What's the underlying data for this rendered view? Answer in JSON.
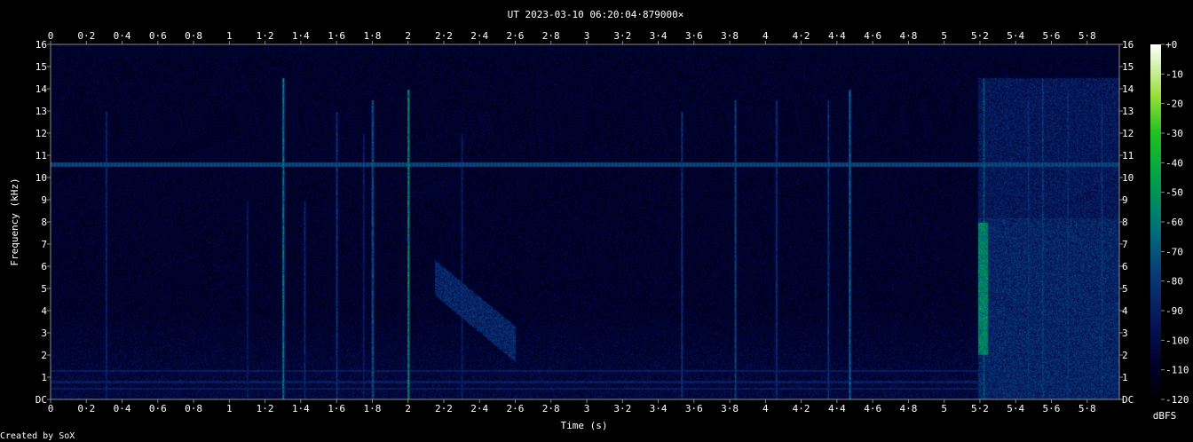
{
  "title": "UT 2023-03-10 06:20:04·879000×",
  "footer": "Created by SoX",
  "chart_data": {
    "type": "heatmap",
    "title": "UT 2023-03-10 06:20:04·879000×",
    "xlabel": "Time (s)",
    "ylabel": "Frequency (kHz)",
    "xlim": [
      0,
      5.98
    ],
    "ylim": [
      0,
      16
    ],
    "x_ticks": [
      "0",
      "0·2",
      "0·4",
      "0·6",
      "0·8",
      "1",
      "1·2",
      "1·4",
      "1·6",
      "1·8",
      "2",
      "2·2",
      "2·4",
      "2·6",
      "2·8",
      "3",
      "3·2",
      "3·4",
      "3·6",
      "3·8",
      "4",
      "4·2",
      "4·4",
      "4·6",
      "4·8",
      "5",
      "5·2",
      "5·4",
      "5·6",
      "5·8"
    ],
    "x_tick_values": [
      0,
      0.2,
      0.4,
      0.6,
      0.8,
      1,
      1.2,
      1.4,
      1.6,
      1.8,
      2,
      2.2,
      2.4,
      2.6,
      2.8,
      3,
      3.2,
      3.4,
      3.6,
      3.8,
      4,
      4.2,
      4.4,
      4.6,
      4.8,
      5,
      5.2,
      5.4,
      5.6,
      5.8
    ],
    "y_ticks": [
      "DC",
      "1",
      "2",
      "3",
      "4",
      "5",
      "6",
      "7",
      "8",
      "9",
      "10",
      "11",
      "12",
      "13",
      "14",
      "15",
      "16"
    ],
    "y_tick_values": [
      0,
      1,
      2,
      3,
      4,
      5,
      6,
      7,
      8,
      9,
      10,
      11,
      12,
      13,
      14,
      15,
      16
    ],
    "colorbar": {
      "label": "dBFS",
      "ticks": [
        "+0",
        "-10",
        "-20",
        "-30",
        "-40",
        "-50",
        "-60",
        "-70",
        "-80",
        "-90",
        "-100",
        "-110",
        "-120"
      ],
      "tick_values": [
        0,
        -10,
        -20,
        -30,
        -40,
        -50,
        -60,
        -70,
        -80,
        -90,
        -100,
        -110,
        -120
      ],
      "range": [
        -120,
        0
      ]
    },
    "features": {
      "hum_line_khz": 10.6,
      "low_bands_khz": [
        0.5,
        0.8,
        1.3
      ],
      "impulses": [
        {
          "t": 0.31,
          "fmax": 13,
          "level": 0.4
        },
        {
          "t": 1.1,
          "fmax": 9,
          "level": 0.35
        },
        {
          "t": 1.3,
          "fmax": 14.5,
          "level": 0.75
        },
        {
          "t": 1.42,
          "fmax": 9,
          "level": 0.4
        },
        {
          "t": 1.6,
          "fmax": 13,
          "level": 0.45
        },
        {
          "t": 1.75,
          "fmax": 12,
          "level": 0.35
        },
        {
          "t": 1.8,
          "fmax": 13.5,
          "level": 0.6
        },
        {
          "t": 2.0,
          "fmax": 14,
          "level": 0.8
        },
        {
          "t": 2.3,
          "fmax": 12,
          "level": 0.35
        },
        {
          "t": 3.53,
          "fmax": 13,
          "level": 0.45
        },
        {
          "t": 3.83,
          "fmax": 13.5,
          "level": 0.5
        },
        {
          "t": 4.06,
          "fmax": 13.5,
          "level": 0.45
        },
        {
          "t": 4.35,
          "fmax": 13.5,
          "level": 0.45
        },
        {
          "t": 4.47,
          "fmax": 14,
          "level": 0.65
        },
        {
          "t": 5.22,
          "fmax": 14.5,
          "level": 0.55
        },
        {
          "t": 5.47,
          "fmax": 13.5,
          "level": 0.45
        },
        {
          "t": 5.55,
          "fmax": 14.5,
          "level": 0.5
        },
        {
          "t": 5.69,
          "fmax": 14,
          "level": 0.45
        },
        {
          "t": 5.88,
          "fmax": 13.5,
          "level": 0.45
        }
      ],
      "chirp": {
        "t_start": 2.15,
        "f_start": 5.5,
        "t_end": 2.6,
        "f_end": 2.5
      },
      "burst": {
        "t_start": 5.19,
        "t_end": 5.98,
        "fmax": 14.5
      }
    }
  }
}
